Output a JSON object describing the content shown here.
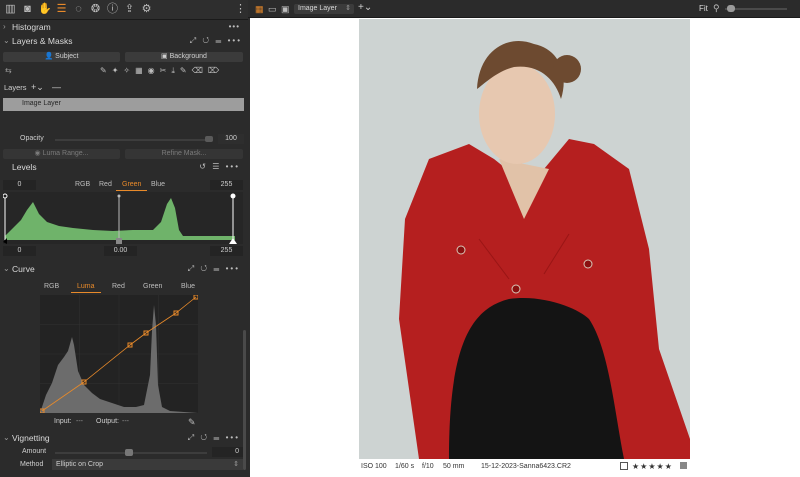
{
  "toolbar_icons": [
    "library-icon",
    "camera-icon",
    "hand-icon",
    "adjustments-icon",
    "color-wheel-icon",
    "styles-icon",
    "info-icon",
    "export-icon",
    "settings-icon",
    "more-vertical-icon"
  ],
  "histogram": {
    "title": "Histogram",
    "more": "•••"
  },
  "layers_masks": {
    "title": "Layers & Masks",
    "subject_label": "Subject",
    "background_label": "Background",
    "layers_label": "Layers",
    "layer_name": "Image Layer",
    "opacity_label": "Opacity",
    "opacity_value": "100",
    "luma_range_label": "Luma Range...",
    "refine_mask_label": "Refine Mask..."
  },
  "levels": {
    "title": "Levels",
    "left_value": "0",
    "right_value": "255",
    "channels": [
      "RGB",
      "Red",
      "Green",
      "Blue"
    ],
    "selected_channel": "Green",
    "bottom_left": "0",
    "bottom_mid": "0.00",
    "bottom_right": "255",
    "more": "•••"
  },
  "curve": {
    "title": "Curve",
    "channels": [
      "RGB",
      "Luma",
      "Red",
      "Green",
      "Blue"
    ],
    "selected_channel": "Luma",
    "input_label": "Input:",
    "input_value": "---",
    "output_label": "Output:",
    "output_value": "---",
    "more": "•••"
  },
  "vignetting": {
    "title": "Vignetting",
    "amount_label": "Amount",
    "amount_value": "0",
    "method_label": "Method",
    "method_value": "Elliptic on Crop",
    "more": "•••"
  },
  "viewer": {
    "layer_select": "Image Layer",
    "fit_label": "Fit",
    "photo_description": "Portrait of woman in red jacket and black lace tights"
  },
  "status": {
    "iso": "ISO 100",
    "shutter": "1/60 s",
    "aperture": "f/10",
    "focal": "50 mm",
    "filename": "15-12-2023-Sanna6423.CR2",
    "stars": "★★★★★"
  },
  "colors": {
    "accent": "#e88a2a",
    "green_hist": "#6fb36a",
    "panel": "#2b2b2b"
  }
}
